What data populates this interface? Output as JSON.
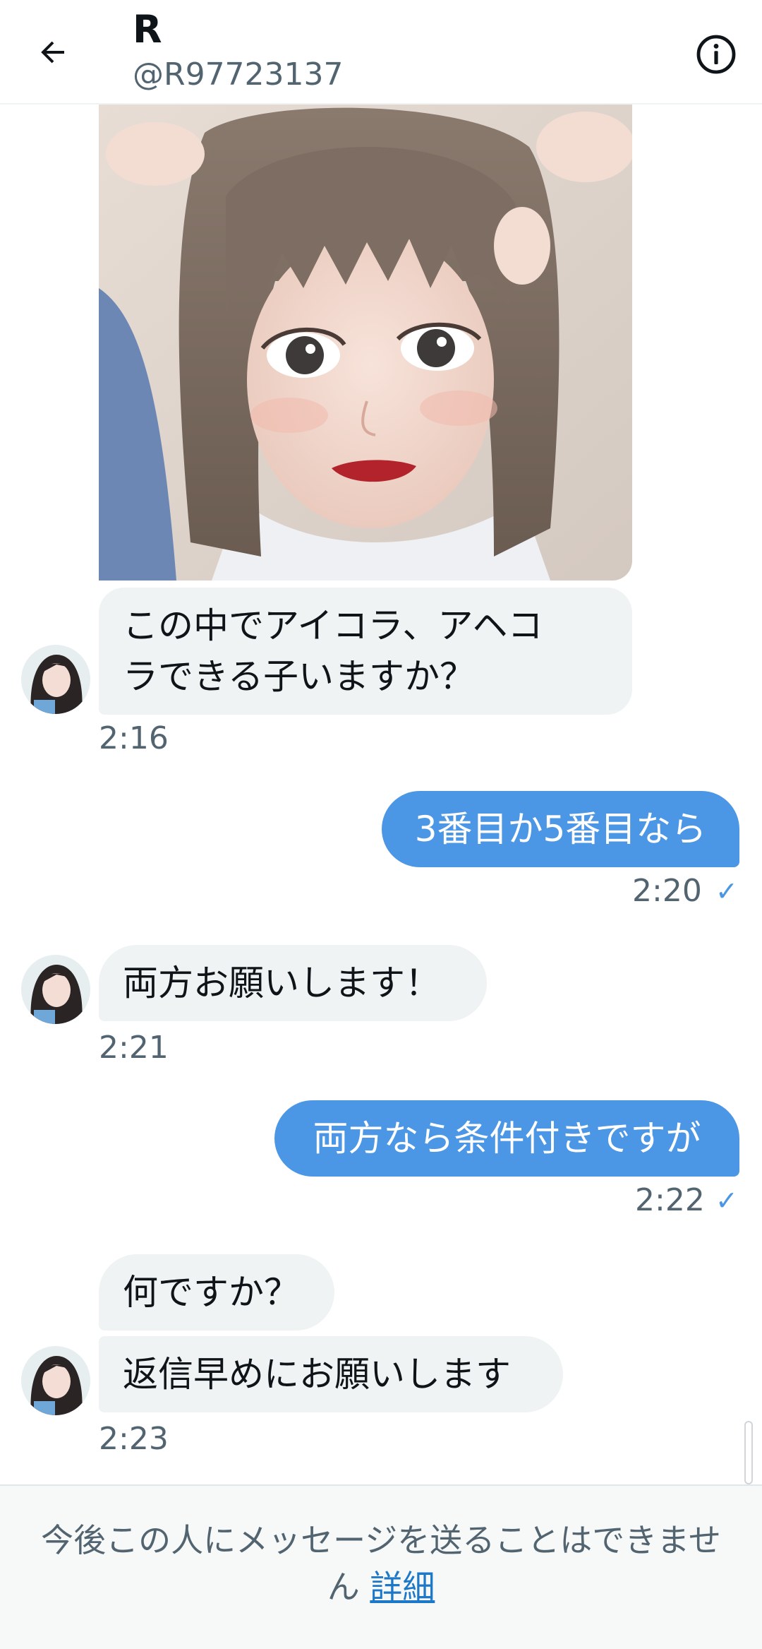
{
  "header": {
    "name": "R",
    "handle": "@R97723137"
  },
  "messages": [
    {
      "direction": "in",
      "text_lines": [
        "この中でアイコラ、アヘコ",
        "ラできる子いますか？"
      ],
      "time": "2:16"
    },
    {
      "direction": "out",
      "text": "3番目か5番目なら",
      "time": "2:20",
      "status": "✓"
    },
    {
      "direction": "in",
      "text": "両方お願いします！",
      "time": "2:21"
    },
    {
      "direction": "out",
      "text": "両方なら条件付きですが",
      "time": "2:22",
      "status": "✓"
    },
    {
      "direction": "in",
      "text": "何ですか？"
    },
    {
      "direction": "in",
      "text": "返信早めにお願いします",
      "time": "2:23"
    }
  ],
  "footer": {
    "notice": "今後この人にメッセージを送ることはできません",
    "link": "詳細"
  },
  "colors": {
    "outgoing_bubble": "#4c96e6",
    "incoming_bubble": "#eff3f4",
    "secondary_text": "#536471",
    "link": "#1d78c8"
  },
  "icons": {
    "back": "arrow-left-icon",
    "info": "info-circle-icon",
    "read_receipt": "checkmark-icon"
  }
}
